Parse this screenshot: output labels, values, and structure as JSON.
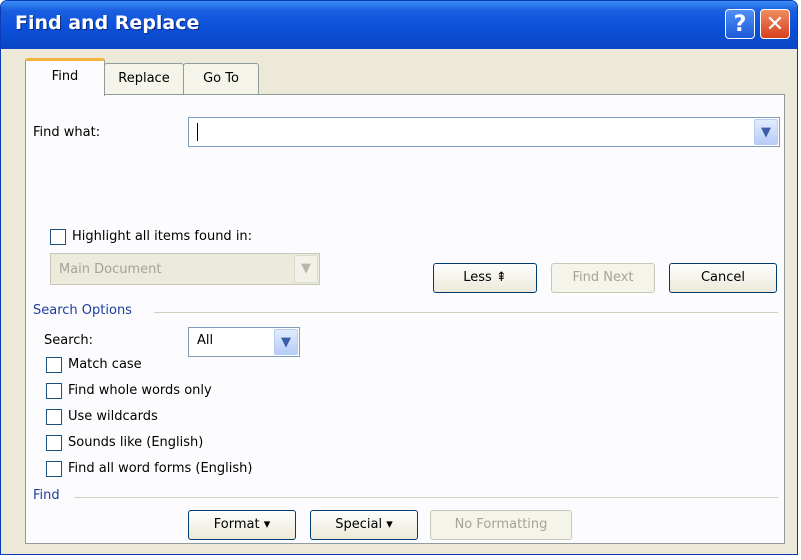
{
  "window": {
    "title": "Find and Replace",
    "help_label": "?",
    "close_label": "✕"
  },
  "tabs": [
    {
      "label": "Find",
      "active": true
    },
    {
      "label": "Replace",
      "active": false
    },
    {
      "label": "Go To",
      "active": false
    }
  ],
  "find": {
    "label": "Find what:",
    "value": ""
  },
  "highlight": {
    "label": "Highlight all items found in:",
    "checked": false,
    "select_value": "Main Document"
  },
  "buttons": {
    "less": "Less ⇞",
    "find_next": "Find Next",
    "cancel": "Cancel"
  },
  "search_options": {
    "group_label": "Search Options",
    "search_label": "Search:",
    "search_value": "All",
    "checkboxes": [
      {
        "label": "Match case",
        "checked": false
      },
      {
        "label": "Find whole words only",
        "checked": false
      },
      {
        "label": "Use wildcards",
        "checked": false
      },
      {
        "label": "Sounds like (English)",
        "checked": false
      },
      {
        "label": "Find all word forms (English)",
        "checked": false
      }
    ]
  },
  "find_group": {
    "label": "Find",
    "format": "Format ▾",
    "special": "Special ▾",
    "no_formatting": "No Formatting"
  },
  "icons": {
    "dropdown": "chevron-down-icon"
  }
}
